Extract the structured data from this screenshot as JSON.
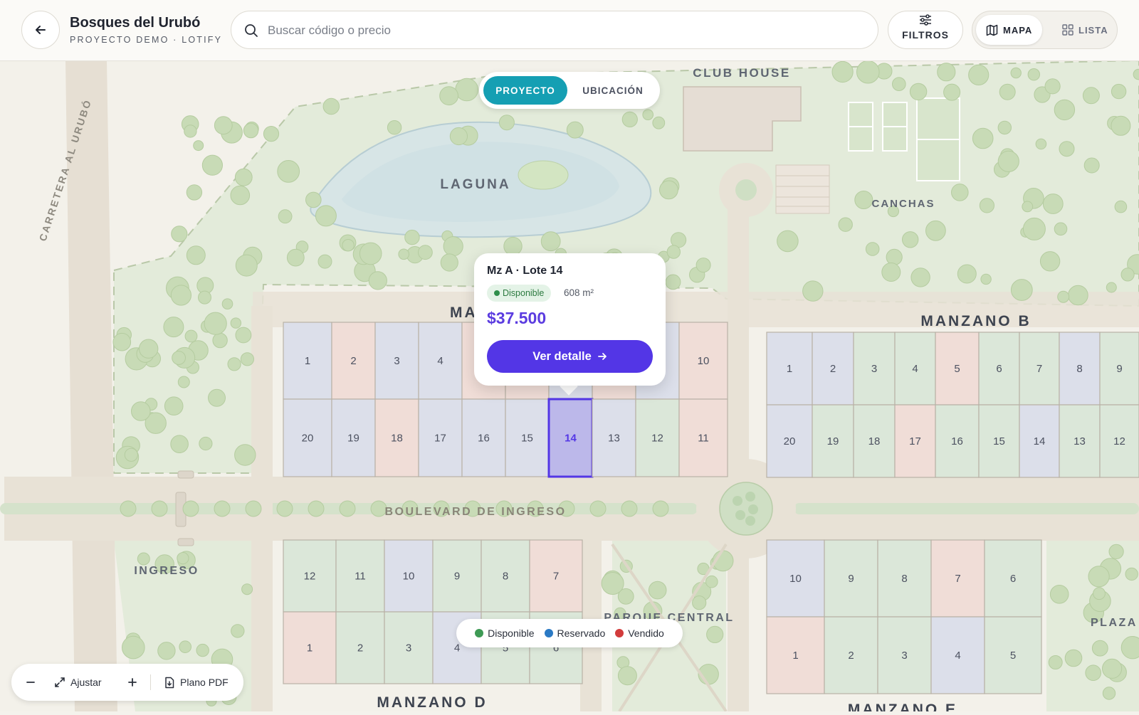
{
  "header": {
    "title": "Bosques del Urubó",
    "subtitle": "PROYECTO DEMO · LOTIFY",
    "search_placeholder": "Buscar código o precio",
    "filters_label": "FILTROS",
    "view_map_label": "MAPA",
    "view_list_label": "LISTA"
  },
  "map_tabs": {
    "project": "PROYECTO",
    "location": "UBICACIÓN"
  },
  "labels": {
    "road": "CARRETERA AL URUBÓ",
    "club_house": "CLUB HOUSE",
    "lagoon": "LAGUNA",
    "courts": "CANCHAS",
    "block_a": "MANZANO A",
    "block_b": "MANZANO B",
    "block_d": "MANZANO D",
    "block_e": "MANZANO E",
    "boulevard": "BOULEVARD DE INGRESO",
    "entrance": "INGRESO",
    "park": "PARQUE CENTRAL",
    "plaza": "PLAZA"
  },
  "colors": {
    "available": "#dbe7d9",
    "reserved": "#dcdfea",
    "sold": "#f0ddd7",
    "selected": "#bcb8ea",
    "accent": "#5336e6",
    "teal": "#159fb3"
  },
  "blocks": {
    "A_top": [
      {
        "n": "1",
        "s": "reserved"
      },
      {
        "n": "2",
        "s": "sold"
      },
      {
        "n": "3",
        "s": "reserved"
      },
      {
        "n": "4",
        "s": "reserved"
      },
      {
        "n": "",
        "s": "sold"
      },
      {
        "n": "",
        "s": "sold"
      },
      {
        "n": "",
        "s": "reserved"
      },
      {
        "n": "",
        "s": "sold"
      },
      {
        "n": "",
        "s": "reserved"
      },
      {
        "n": "10",
        "s": "sold"
      }
    ],
    "A_bottom": [
      {
        "n": "20",
        "s": "reserved"
      },
      {
        "n": "19",
        "s": "reserved"
      },
      {
        "n": "18",
        "s": "sold"
      },
      {
        "n": "17",
        "s": "reserved"
      },
      {
        "n": "16",
        "s": "reserved"
      },
      {
        "n": "15",
        "s": "reserved"
      },
      {
        "n": "14",
        "s": "selected"
      },
      {
        "n": "13",
        "s": "reserved"
      },
      {
        "n": "12",
        "s": "available"
      },
      {
        "n": "11",
        "s": "sold"
      }
    ],
    "B_top": [
      {
        "n": "1",
        "s": "reserved"
      },
      {
        "n": "2",
        "s": "reserved"
      },
      {
        "n": "3",
        "s": "available"
      },
      {
        "n": "4",
        "s": "available"
      },
      {
        "n": "5",
        "s": "sold"
      },
      {
        "n": "6",
        "s": "available"
      },
      {
        "n": "7",
        "s": "available"
      },
      {
        "n": "8",
        "s": "reserved"
      },
      {
        "n": "9",
        "s": "available"
      }
    ],
    "B_bottom": [
      {
        "n": "20",
        "s": "reserved"
      },
      {
        "n": "19",
        "s": "available"
      },
      {
        "n": "18",
        "s": "available"
      },
      {
        "n": "17",
        "s": "sold"
      },
      {
        "n": "16",
        "s": "available"
      },
      {
        "n": "15",
        "s": "available"
      },
      {
        "n": "14",
        "s": "reserved"
      },
      {
        "n": "13",
        "s": "available"
      },
      {
        "n": "12",
        "s": "available"
      }
    ],
    "D_top": [
      {
        "n": "12",
        "s": "available"
      },
      {
        "n": "11",
        "s": "available"
      },
      {
        "n": "10",
        "s": "reserved"
      },
      {
        "n": "9",
        "s": "available"
      },
      {
        "n": "8",
        "s": "available"
      },
      {
        "n": "7",
        "s": "sold"
      }
    ],
    "D_bottom": [
      {
        "n": "1",
        "s": "sold"
      },
      {
        "n": "2",
        "s": "available"
      },
      {
        "n": "3",
        "s": "available"
      },
      {
        "n": "4",
        "s": "reserved"
      },
      {
        "n": "5",
        "s": "available"
      },
      {
        "n": "6",
        "s": "available"
      }
    ],
    "E_top": [
      {
        "n": "10",
        "s": "reserved"
      },
      {
        "n": "9",
        "s": "available"
      },
      {
        "n": "8",
        "s": "available"
      },
      {
        "n": "7",
        "s": "sold"
      },
      {
        "n": "6",
        "s": "available"
      }
    ],
    "E_bottom": [
      {
        "n": "1",
        "s": "sold"
      },
      {
        "n": "2",
        "s": "available"
      },
      {
        "n": "3",
        "s": "available"
      },
      {
        "n": "4",
        "s": "reserved"
      },
      {
        "n": "5",
        "s": "available"
      }
    ]
  },
  "popup": {
    "title": "Mz A · Lote 14",
    "status": "Disponible",
    "area": "608 m²",
    "price": "$37.500",
    "cta": "Ver detalle"
  },
  "legend": {
    "available": {
      "label": "Disponible",
      "color": "#3e9a55"
    },
    "reserved": {
      "label": "Reservado",
      "color": "#2a79c4"
    },
    "sold": {
      "label": "Vendido",
      "color": "#d23c3c"
    }
  },
  "toolbar": {
    "fit_label": "Ajustar",
    "pdf_label": "Plano PDF"
  }
}
